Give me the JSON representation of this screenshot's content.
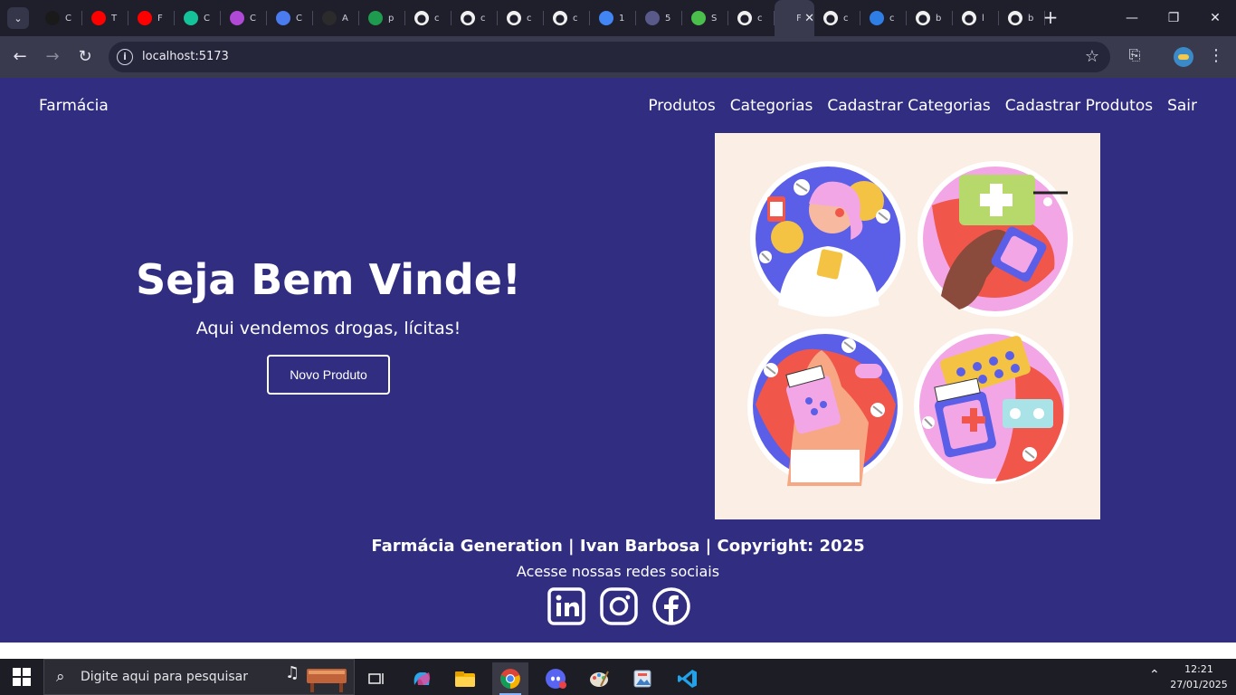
{
  "browser": {
    "tabs": [
      {
        "label": "C",
        "icon": "eu-icon",
        "color": "#1a1a1a"
      },
      {
        "label": "T",
        "icon": "youtube-icon",
        "color": "#ff0000"
      },
      {
        "label": "F",
        "icon": "youtube-icon",
        "color": "#ff0000"
      },
      {
        "label": "C",
        "icon": "grammarly-icon",
        "color": "#15c39a"
      },
      {
        "label": "C",
        "icon": "app-icon",
        "color": "#b04ad6"
      },
      {
        "label": "C",
        "icon": "gemini-icon",
        "color": "#4a7cf0"
      },
      {
        "label": "A",
        "icon": "chatgpt-icon",
        "color": "#2b2b2b"
      },
      {
        "label": "p",
        "icon": "sheets-icon",
        "color": "#1e9b4f"
      },
      {
        "label": "c",
        "icon": "github-icon",
        "color": "#f0f0f0"
      },
      {
        "label": "c",
        "icon": "github-icon",
        "color": "#f0f0f0"
      },
      {
        "label": "c",
        "icon": "github-icon",
        "color": "#f0f0f0"
      },
      {
        "label": "c",
        "icon": "github-icon",
        "color": "#f0f0f0"
      },
      {
        "label": "1",
        "icon": "docs-icon",
        "color": "#4285f4"
      },
      {
        "label": "5",
        "icon": "dots-icon",
        "color": "#5a5a8a"
      },
      {
        "label": "S",
        "icon": "globe-icon",
        "color": "#4bbf4b"
      },
      {
        "label": "c",
        "icon": "github-icon",
        "color": "#f0f0f0"
      },
      {
        "label": "F",
        "icon": "page-icon",
        "color": "#3a3a4e",
        "active": true
      },
      {
        "label": "c",
        "icon": "github-icon",
        "color": "#f0f0f0"
      },
      {
        "label": "c",
        "icon": "jira-icon",
        "color": "#2f7ee6"
      },
      {
        "label": "b",
        "icon": "github-icon",
        "color": "#f0f0f0"
      },
      {
        "label": "l",
        "icon": "github-icon",
        "color": "#f0f0f0"
      },
      {
        "label": "b",
        "icon": "github-icon",
        "color": "#f0f0f0"
      }
    ],
    "url": "localhost:5173"
  },
  "navbar": {
    "brand": "Farmácia",
    "links": [
      "Produtos",
      "Categorias",
      "Cadastrar Categorias",
      "Cadastrar Produtos",
      "Sair"
    ]
  },
  "hero": {
    "title": "Seja Bem Vinde!",
    "subtitle": "Aqui vendemos drogas, lícitas!",
    "button": "Novo Produto"
  },
  "footer": {
    "title": "Farmácia Generation | Ivan Barbosa | Copyright: 2025",
    "subtitle": "Acesse nossas redes sociais",
    "social": [
      "linkedin-icon",
      "instagram-icon",
      "facebook-icon"
    ]
  },
  "taskbar": {
    "search_placeholder": "Digite aqui para pesquisar",
    "time": "12:21",
    "date": "27/01/2025"
  },
  "colors": {
    "page_bg": "#312e81",
    "illustration_bg": "#fbeee4",
    "accent_blue": "#5b5fe8",
    "accent_red": "#f0564a",
    "accent_pink": "#f3a6e6"
  }
}
